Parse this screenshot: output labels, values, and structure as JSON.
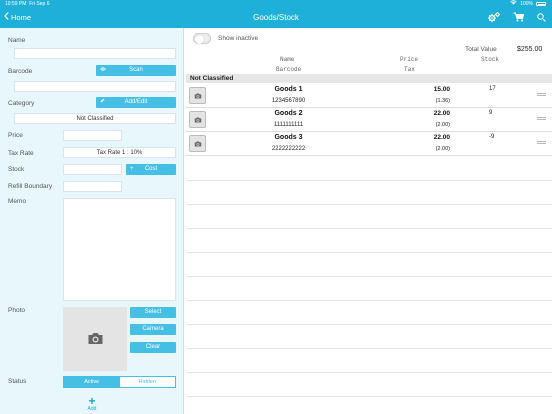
{
  "statusbar": {
    "time": "10:59 PM",
    "date": "Fri Sep 6",
    "battery": "100%"
  },
  "nav": {
    "back_label": "Home",
    "title": "Goods/Stock"
  },
  "form": {
    "name_label": "Name",
    "barcode_label": "Barcode",
    "scan_label": "Scan",
    "category_label": "Category",
    "add_edit_label": "Add/Edit",
    "category_value": "Not Classified",
    "price_label": "Price",
    "tax_rate_label": "Tax Rate",
    "tax_rate_value": "Tax Rate 1 : 10%",
    "stock_label": "Stock",
    "cost_label": "Cost",
    "refill_label": "Refill Boundary",
    "memo_label": "Memo",
    "photo_label": "Photo",
    "select_label": "Select",
    "camera_label": "Camera",
    "clear_label": "Clear",
    "status_label": "Status",
    "active_label": "Active",
    "hidden_label": "Hidden",
    "add_label": "Add"
  },
  "list": {
    "show_inactive_label": "Show inactive",
    "total_value_label": "Total Value",
    "total_value": "$255.00",
    "headers": {
      "name": "Name",
      "barcode": "Barcode",
      "price": "Price",
      "tax": "Tax",
      "stock": "Stock"
    },
    "section": "Not Classified",
    "rows": [
      {
        "name": "Goods 1",
        "barcode": "1234567890",
        "price": "15.00",
        "tax": "(1.36)",
        "stock": "17"
      },
      {
        "name": "Goods 2",
        "barcode": "1111111111",
        "price": "22.00",
        "tax": "(2.00)",
        "stock": "9"
      },
      {
        "name": "Goods 3",
        "barcode": "2222222222",
        "price": "22.00",
        "tax": "(2.00)",
        "stock": "-9"
      }
    ]
  },
  "colors": {
    "accent": "#1fb0d9",
    "button": "#45bfe3",
    "panel": "#e8f7fc"
  }
}
